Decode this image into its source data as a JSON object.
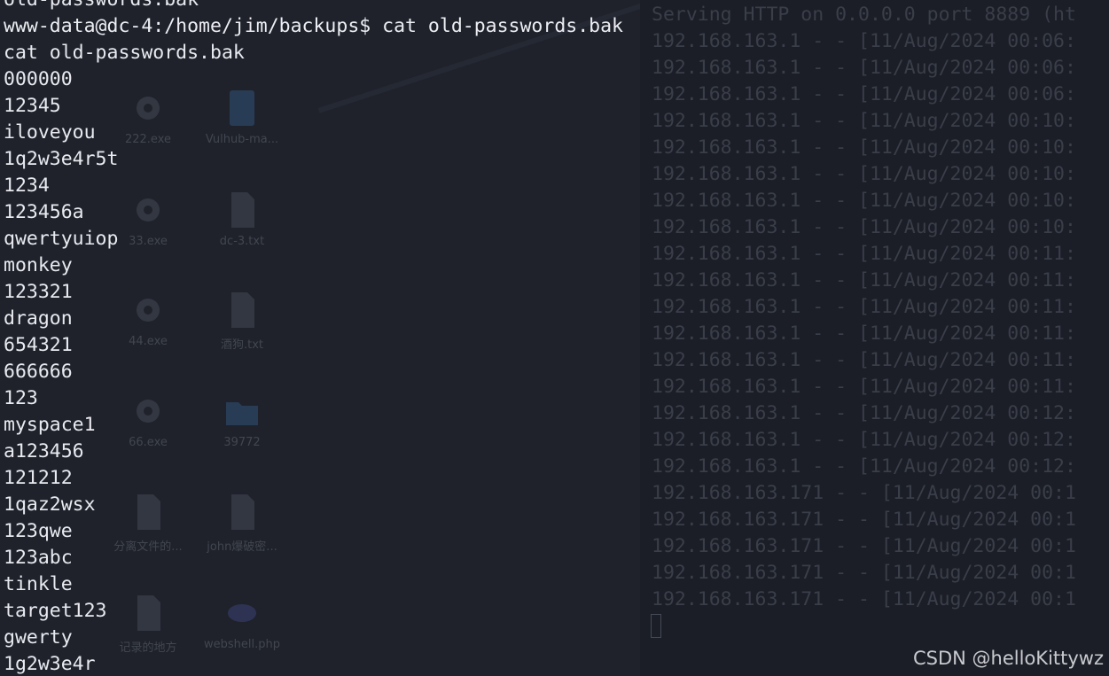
{
  "terminal": {
    "partial_top_line": "old-passwords.bak",
    "prompt_line": "www-data@dc-4:/home/jim/backups$ cat old-passwords.bak",
    "echo_line": "cat old-passwords.bak",
    "output_lines": [
      "000000",
      "12345",
      "iloveyou",
      "1q2w3e4r5t",
      "1234",
      "123456a",
      "qwertyuiop",
      "monkey",
      "123321",
      "dragon",
      "654321",
      "666666",
      "123",
      "myspace1",
      "a123456",
      "121212",
      "1qaz2wsx",
      "123qwe",
      "123abc",
      "tinkle",
      "target123",
      "gwerty",
      "1g2w3e4r"
    ]
  },
  "server_log": {
    "header_line": "Serving HTTP on 0.0.0.0 port 8889 (ht",
    "lines": [
      "192.168.163.1 - - [11/Aug/2024 00:06:",
      "192.168.163.1 - - [11/Aug/2024 00:06:",
      "192.168.163.1 - - [11/Aug/2024 00:06:",
      "192.168.163.1 - - [11/Aug/2024 00:10:",
      "192.168.163.1 - - [11/Aug/2024 00:10:",
      "192.168.163.1 - - [11/Aug/2024 00:10:",
      "192.168.163.1 - - [11/Aug/2024 00:10:",
      "192.168.163.1 - - [11/Aug/2024 00:10:",
      "192.168.163.1 - - [11/Aug/2024 00:11:",
      "192.168.163.1 - - [11/Aug/2024 00:11:",
      "192.168.163.1 - - [11/Aug/2024 00:11:",
      "192.168.163.1 - - [11/Aug/2024 00:11:",
      "192.168.163.1 - - [11/Aug/2024 00:11:",
      "192.168.163.1 - - [11/Aug/2024 00:11:",
      "192.168.163.1 - - [11/Aug/2024 00:12:",
      "192.168.163.1 - - [11/Aug/2024 00:12:",
      "192.168.163.1 - - [11/Aug/2024 00:12:",
      "192.168.163.171 - - [11/Aug/2024 00:1",
      "192.168.163.171 - - [11/Aug/2024 00:1",
      "192.168.163.171 - - [11/Aug/2024 00:1",
      "192.168.163.171 - - [11/Aug/2024 00:1",
      "192.168.163.171 - - [11/Aug/2024 00:1"
    ]
  },
  "desktop_icons": [
    {
      "label": "222.exe",
      "icon": "gear-icon"
    },
    {
      "label": "Vulhub-ma...",
      "icon": "archive-icon"
    },
    {
      "label": "33.exe",
      "icon": "gear-icon"
    },
    {
      "label": "dc-3.txt",
      "icon": "document-icon"
    },
    {
      "label": "44.exe",
      "icon": "gear-icon"
    },
    {
      "label": "酒狗.txt",
      "icon": "document-icon"
    },
    {
      "label": "66.exe",
      "icon": "gear-icon"
    },
    {
      "label": "39772",
      "icon": "folder-icon"
    },
    {
      "label": "分离文件的...",
      "icon": "document-icon"
    },
    {
      "label": "john爆破密...",
      "icon": "document-icon"
    },
    {
      "label": "记录的地方",
      "icon": "document-icon"
    },
    {
      "label": "webshell.php",
      "icon": "php-file-icon"
    }
  ],
  "watermark": "CSDN @helloKittywz"
}
